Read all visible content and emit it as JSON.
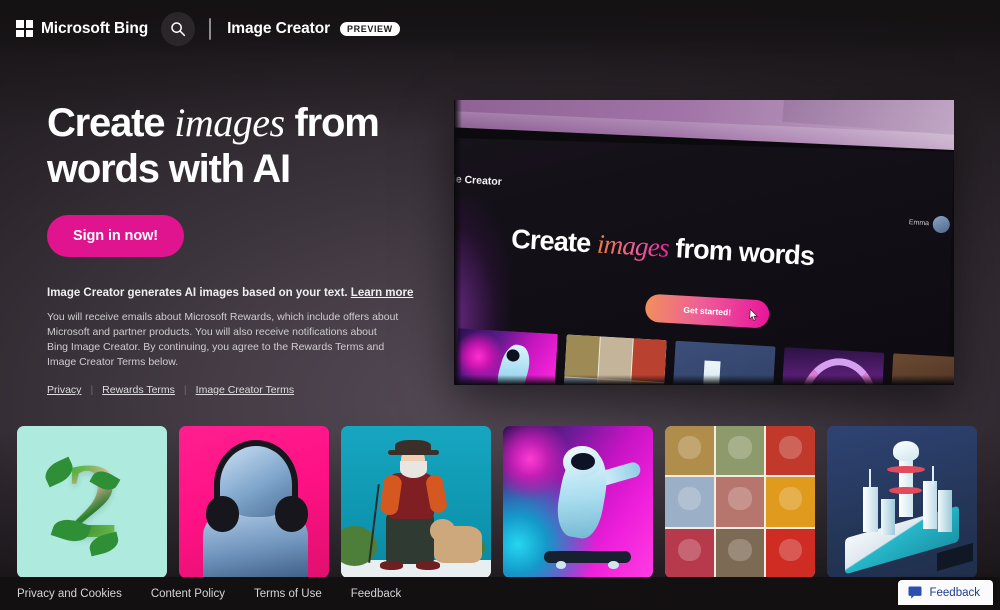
{
  "header": {
    "brand": "Microsoft Bing",
    "search_icon": "search-icon",
    "app_title": "Image Creator",
    "preview_badge": "PREVIEW"
  },
  "hero": {
    "headline_part1": "Create ",
    "headline_em": "images",
    "headline_part2": " from words with AI",
    "signin_label": "Sign in now!",
    "disclaimer_title": "Image Creator generates AI images based on your text. ",
    "learn_more": "Learn more",
    "disclaimer_body": "You will receive emails about Microsoft Rewards, which include offers about Microsoft and partner products. You will also receive notifications about Bing Image Creator. By continuing, you agree to the Rewards Terms and Image Creator Terms below.",
    "legal": [
      {
        "label": "Privacy"
      },
      {
        "label": "Rewards Terms"
      },
      {
        "label": "Image Creator Terms"
      }
    ]
  },
  "hero_shot": {
    "app_label": "je Creator",
    "user_name": "Emma",
    "headline_part1": "Create ",
    "headline_em": "images",
    "headline_part2": " from words",
    "cta_label": "Get started!",
    "thumbnails": [
      {
        "name": "astronaut-dabbing-in-space"
      },
      {
        "name": "portrait-collage-grid"
      },
      {
        "name": "isometric-futuristic-city"
      },
      {
        "name": "neon-rainbow-clouds"
      },
      {
        "name": "portrait-warm-tones"
      }
    ]
  },
  "gallery": [
    {
      "name": "number-two-made-of-leaves",
      "caption": "2"
    },
    {
      "name": "classical-bust-with-headphones"
    },
    {
      "name": "old-man-walking-dog"
    },
    {
      "name": "astronaut-on-skateboard"
    },
    {
      "name": "frida-style-portrait-collage"
    },
    {
      "name": "isometric-white-city"
    }
  ],
  "footer": {
    "links": [
      {
        "label": "Privacy and Cookies"
      },
      {
        "label": "Content Policy"
      },
      {
        "label": "Terms of Use"
      },
      {
        "label": "Feedback"
      }
    ],
    "feedback_widget": "Feedback"
  },
  "colors": {
    "accent_pink": "#e0148f",
    "link_blue": "#1d3a8f",
    "background": "#231e21"
  }
}
